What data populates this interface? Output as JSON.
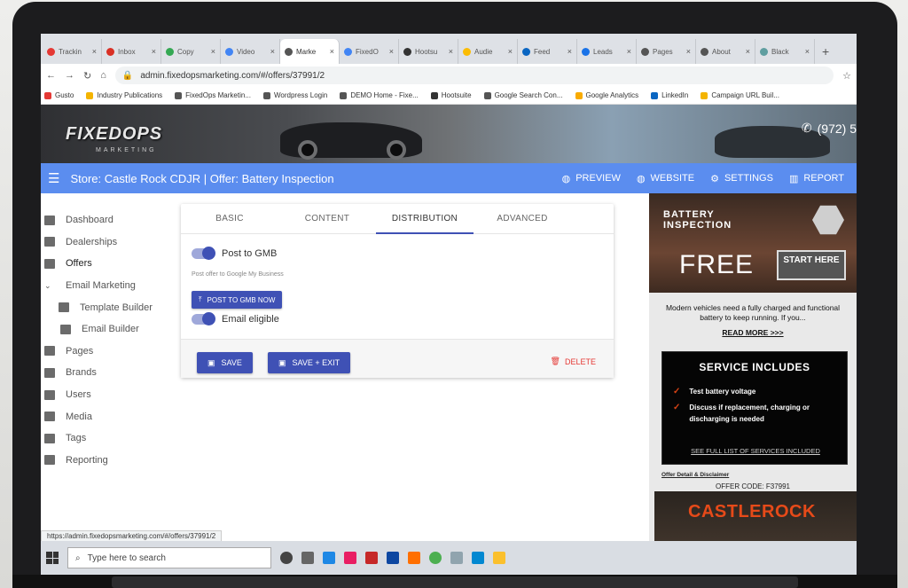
{
  "browser": {
    "tabs": [
      {
        "label": "Trackin",
        "color": "#e53935",
        "active": false
      },
      {
        "label": "Inbox",
        "color": "#d93025",
        "active": false
      },
      {
        "label": "Copy",
        "color": "#34a853",
        "active": false
      },
      {
        "label": "Video",
        "color": "#4285f4",
        "active": false
      },
      {
        "label": "Marke",
        "color": "#555555",
        "active": true
      },
      {
        "label": "FixedO",
        "color": "#4285f4",
        "active": false
      },
      {
        "label": "Hootsu",
        "color": "#333333",
        "active": false
      },
      {
        "label": "Audie",
        "color": "#fbbc04",
        "active": false
      },
      {
        "label": "Feed",
        "color": "#0a66c2",
        "active": false
      },
      {
        "label": "Leads",
        "color": "#1a73e8",
        "active": false
      },
      {
        "label": "Pages",
        "color": "#555555",
        "active": false
      },
      {
        "label": "About",
        "color": "#555555",
        "active": false
      },
      {
        "label": "Black",
        "color": "#5f9ea0",
        "active": false
      }
    ],
    "url": "admin.fixedopsmarketing.com/#/offers/37991/2",
    "bookmarks": [
      {
        "label": "Gusto",
        "color": "#e53935"
      },
      {
        "label": "Industry Publications",
        "color": "#f4b400"
      },
      {
        "label": "FixedOps Marketin...",
        "color": "#555555"
      },
      {
        "label": "Wordpress Login",
        "color": "#555555"
      },
      {
        "label": "DEMO Home - Fixe...",
        "color": "#555555"
      },
      {
        "label": "Hootsuite",
        "color": "#333333"
      },
      {
        "label": "Google Search Con...",
        "color": "#555555"
      },
      {
        "label": "Google Analytics",
        "color": "#f9ab00"
      },
      {
        "label": "LinkedIn",
        "color": "#0a66c2"
      },
      {
        "label": "Campaign URL Buil...",
        "color": "#f4b400"
      }
    ],
    "status_url": "https://admin.fixedopsmarketing.com/#/offers/37991/2"
  },
  "banner": {
    "logo": "FIXEDOPS",
    "logo_sub": "MARKETING",
    "phone": "(972) 5"
  },
  "topnav": {
    "title": "Store: Castle Rock CDJR | Offer: Battery Inspection",
    "preview": "PREVIEW",
    "website": "WEBSITE",
    "settings": "SETTINGS",
    "report": "REPORT"
  },
  "sidebar": {
    "items": [
      {
        "label": "Dashboard"
      },
      {
        "label": "Dealerships"
      },
      {
        "label": "Offers"
      },
      {
        "label": "Email Marketing"
      },
      {
        "label": "Template Builder"
      },
      {
        "label": "Email Builder"
      },
      {
        "label": "Pages"
      },
      {
        "label": "Brands"
      },
      {
        "label": "Users"
      },
      {
        "label": "Media"
      },
      {
        "label": "Tags"
      },
      {
        "label": "Reporting"
      }
    ]
  },
  "editor": {
    "tabs": [
      "BASIC",
      "CONTENT",
      "DISTRIBUTION",
      "ADVANCED"
    ],
    "active_tab": "DISTRIBUTION",
    "post_gmb_label": "Post to GMB",
    "post_gmb_on": true,
    "post_gmb_helper": "Post offer to Google My Business",
    "post_gmb_button": "POST TO GMB NOW",
    "email_eligible_label": "Email eligible",
    "email_eligible_on": true,
    "save": "SAVE",
    "save_exit": "SAVE + EXIT",
    "delete": "DELETE"
  },
  "preview": {
    "title": "BATTERY INSPECTION",
    "free": "FREE",
    "start": "START HERE",
    "description": "Modern vehicles need a fully charged and functional battery to keep running. If you...",
    "read_more": "READ MORE >>>",
    "service_title": "SERVICE INCLUDES",
    "services": [
      "Test battery voltage",
      "Discuss if replacement, charging or discharging is needed"
    ],
    "full_list": "SEE FULL LIST OF SERVICES INCLUDED",
    "disclaimer": "Offer Detail & Disclaimer",
    "offer_code": "OFFER CODE: F37991",
    "brand": "CASTLEROCK"
  },
  "taskbar": {
    "search_placeholder": "Type here to search"
  }
}
